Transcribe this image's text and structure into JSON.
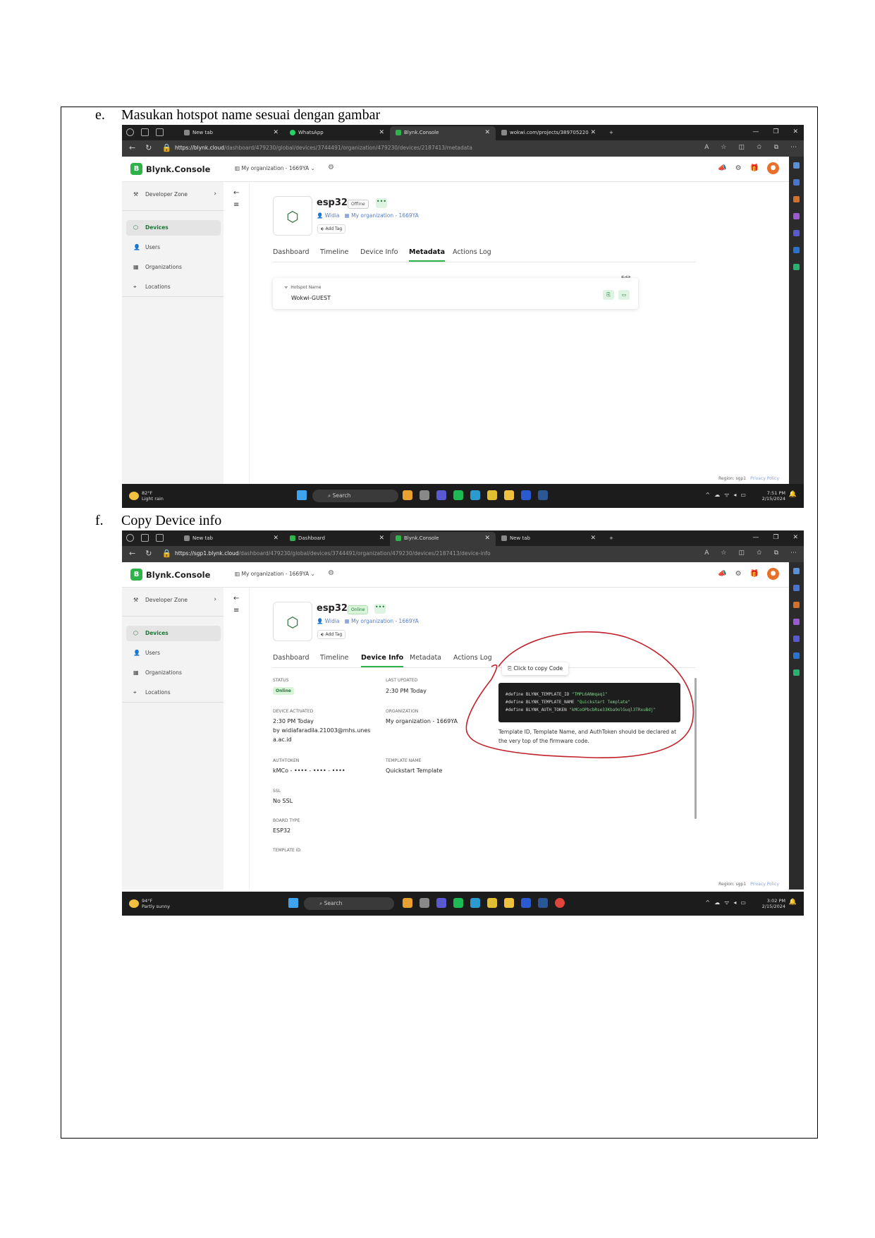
{
  "steps": [
    {
      "letter": "e.",
      "text": "Masukan hotspot name sesuai dengan gambar"
    },
    {
      "letter": "f.",
      "text": "Copy Device info"
    }
  ],
  "shot1": {
    "tabs": [
      "New tab",
      "WhatsApp",
      "Blynk.Console",
      "wokwi.com/projects/389705220"
    ],
    "url_host": "https://blynk.cloud",
    "url_path": "/dashboard/479230/global/devices/3744491/organization/479230/devices/2187413/metadata",
    "device_status": "Offline",
    "active_tab": "Metadata",
    "metadata": {
      "label": "Hotspot Name",
      "value": "Wokwi-GUEST",
      "edit": "Edit"
    },
    "weather": {
      "temp": "82°F",
      "desc": "Light rain"
    },
    "clock": {
      "time": "7:51 PM",
      "date": "2/15/2024"
    }
  },
  "shot2": {
    "tabs": [
      "New tab",
      "Dashboard",
      "Blynk.Console",
      "New tab"
    ],
    "url_host": "https://sgp1.blynk.cloud",
    "url_path": "/dashboard/479230/global/devices/3744491/organization/479230/devices/2187413/device-info",
    "device_status": "Online",
    "active_tab": "Device Info",
    "info": {
      "status_label": "STATUS",
      "status_value": "Online",
      "last_updated_label": "LAST UPDATED",
      "last_updated_value": "2:30 PM Today",
      "activated_label": "DEVICE ACTIVATED",
      "activated_value": "2:30 PM Today",
      "activated_by": "by widiafaradila.21003@mhs.unes",
      "activated_by2": "a.ac.id",
      "org_label": "ORGANIZATION",
      "org_value": "My organization - 1669YA",
      "auth_label": "AUTHTOKEN",
      "auth_value": "kMCo - •••• - •••• - ••••",
      "tmpl_label": "TEMPLATE NAME",
      "tmpl_value": "Quickstart Template",
      "ssl_label": "SSL",
      "ssl_value": "No SSL",
      "board_label": "BOARD TYPE",
      "board_value": "ESP32",
      "tmpl_id_label": "TEMPLATE ID"
    },
    "copy_tip": "Click to copy Code",
    "code_lines": [
      {
        "kw": "#define BLYNK_TEMPLATE_ID ",
        "str": "\"TMPL6ANmqaq1\""
      },
      {
        "kw": "#define BLYNK_TEMPLATE_NAME ",
        "str": "\"Quickstart Template\""
      },
      {
        "kw": "#define BLYNK_AUTH_TOKEN ",
        "str": "\"kMCoOPbcbRse33Kba9olGuql3TRxuBdj\""
      }
    ],
    "code_note": "Template ID, Template Name, and AuthToken should be declared at the very top of the firmware code.",
    "weather": {
      "temp": "94°F",
      "desc": "Partly sunny"
    },
    "clock": {
      "time": "3:02 PM",
      "date": "2/15/2024"
    }
  },
  "common": {
    "brand": "Blynk.Console",
    "org_selector": "My organization - 1669YA",
    "sidebar": [
      "Developer Zone",
      "Devices",
      "Users",
      "Organizations",
      "Locations"
    ],
    "device_name": "esp32",
    "owner": "Widia",
    "owner_org": "My organization - 1669YA",
    "add_tag": "Add Tag",
    "device_tabs": [
      "Dashboard",
      "Timeline",
      "Device Info",
      "Metadata",
      "Actions Log"
    ],
    "region": "Region: sgp1",
    "privacy": "Privacy Policy",
    "search": "Search"
  },
  "annotation_color": "#c0202a"
}
